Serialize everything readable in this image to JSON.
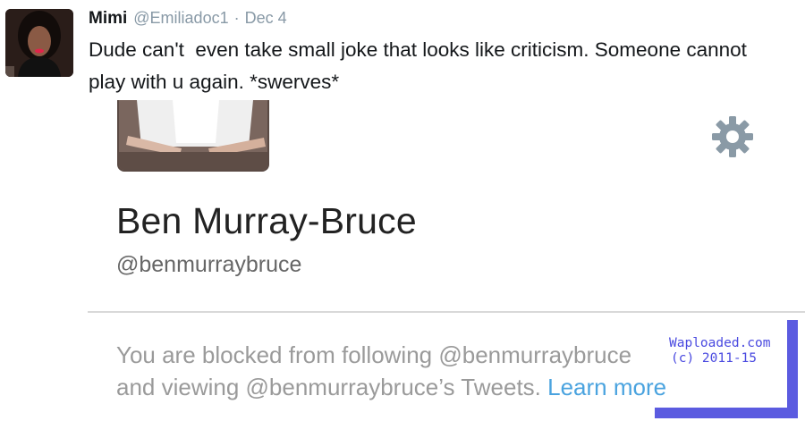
{
  "tweet": {
    "author_name": "Mimi",
    "author_handle": "@Emiliadoc1",
    "separator": "·",
    "date": "Dec 4",
    "text": "Dude can't  even take small joke that looks like criticism. Someone cannot play with u again. *swerves*"
  },
  "profile": {
    "name": "Ben Murray-Bruce",
    "handle": "@benmurraybruce",
    "settings_icon": "gear-icon",
    "blocked_message_line1": "You are blocked from following @benmurraybruce",
    "blocked_message_line2": "and viewing @benmurraybruce’s Tweets.",
    "learn_more_label": "Learn more"
  },
  "watermark": {
    "line1": "Waploaded.com",
    "line2": "(c) 2011-15"
  },
  "colors": {
    "link": "#4aa3df",
    "muted_text": "#9a9a9a",
    "watermark": "#4a4ae0",
    "watermark_frame": "#5b5be0"
  }
}
